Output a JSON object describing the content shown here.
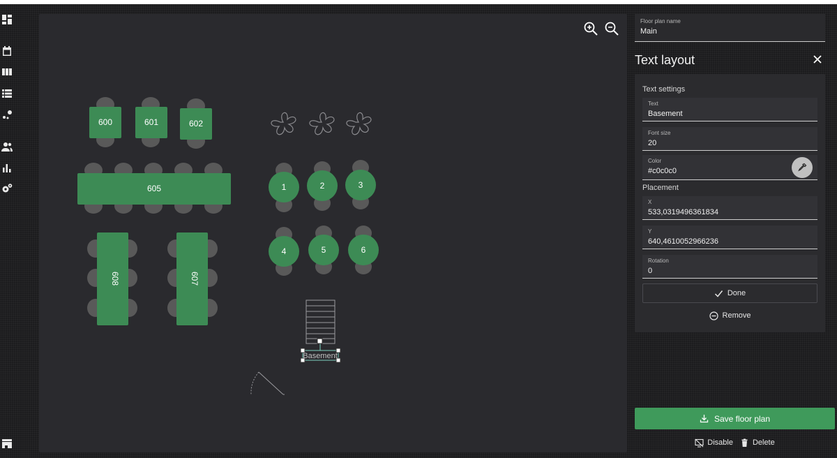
{
  "floor_plan": {
    "name_label": "Floor plan name",
    "name_value": "Main"
  },
  "canvas": {
    "tables": [
      "600",
      "601",
      "602",
      "605",
      "608",
      "607",
      "1",
      "2",
      "3",
      "4",
      "5",
      "6"
    ],
    "selected_text": "Basement"
  },
  "text_layout": {
    "title": "Text layout",
    "text_settings_label": "Text settings",
    "text_label": "Text",
    "text_value": "Basement",
    "font_size_label": "Font size",
    "font_size_value": "20",
    "color_label": "Color",
    "color_value": "#c0c0c0",
    "placement_label": "Placement",
    "x_label": "X",
    "x_value": "533,0319496361834",
    "y_label": "Y",
    "y_value": "640,4610052966236",
    "rotation_label": "Rotation",
    "rotation_value": "0",
    "done_label": "Done",
    "remove_label": "Remove"
  },
  "actions": {
    "save_label": "Save floor plan",
    "disable_label": "Disable",
    "delete_label": "Delete"
  },
  "colors": {
    "table_green": "#3d8b55",
    "chair_gray": "#595959",
    "canvas_bg": "#2a2a2e",
    "save_green": "#3f9a5b"
  },
  "nav_icons": [
    "dashboard-icon",
    "calendar-icon",
    "columns-icon",
    "list-icon",
    "graph-icon",
    "people-icon",
    "bar-chart-icon",
    "settings-icon",
    "store-icon"
  ]
}
